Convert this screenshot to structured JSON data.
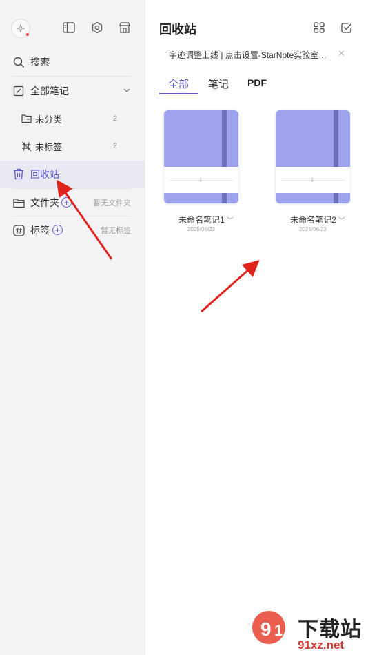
{
  "sidebar": {
    "items": [
      {
        "label": "搜索",
        "icon": "search-icon"
      },
      {
        "label": "全部笔记",
        "icon": "notebook-icon"
      },
      {
        "label": "未分类",
        "count": "2",
        "icon": "unsorted-folder-icon"
      },
      {
        "label": "未标签",
        "count": "2",
        "icon": "untagged-icon"
      },
      {
        "label": "回收站",
        "icon": "trash-icon"
      },
      {
        "label": "文件夹",
        "hint": "暂无文件夹",
        "icon": "folder-icon"
      },
      {
        "label": "标签",
        "hint": "暂无标签",
        "icon": "hashtag-icon"
      }
    ]
  },
  "main": {
    "title": "回收站",
    "notice": "字迹调整上线 | 点击设置-StarNote实验室开启",
    "tabs": [
      {
        "label": "全部"
      },
      {
        "label": "笔记"
      },
      {
        "label": "PDF"
      }
    ],
    "notes": [
      {
        "title": "未命名笔记1",
        "date": "2025/06/23"
      },
      {
        "title": "未命名笔记2",
        "date": "2025/06/23"
      }
    ]
  },
  "watermark": {
    "text": "下载站",
    "url": "91xz.net"
  },
  "colors": {
    "accent": "#5d5ad3",
    "sidebar_bg": "#f4f4f6",
    "cover": "#9da2ec",
    "strap": "#6c71bf",
    "arrow": "#e0231c"
  }
}
